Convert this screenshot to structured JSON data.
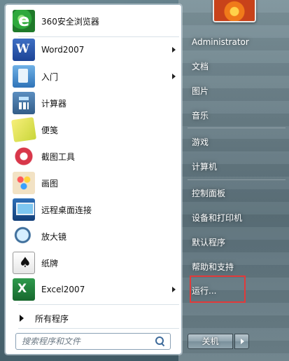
{
  "programs": [
    {
      "label": "360安全浏览器",
      "icon": "browser-360-icon",
      "has_submenu": false
    },
    {
      "label": "Word2007",
      "icon": "word-icon",
      "has_submenu": true
    },
    {
      "label": "入门",
      "icon": "getting-started-icon",
      "has_submenu": true
    },
    {
      "label": "计算器",
      "icon": "calculator-icon",
      "has_submenu": false
    },
    {
      "label": "便笺",
      "icon": "sticky-notes-icon",
      "has_submenu": false
    },
    {
      "label": "截图工具",
      "icon": "snipping-tool-icon",
      "has_submenu": false
    },
    {
      "label": "画图",
      "icon": "paint-icon",
      "has_submenu": false
    },
    {
      "label": "远程桌面连接",
      "icon": "remote-desktop-icon",
      "has_submenu": false
    },
    {
      "label": "放大镜",
      "icon": "magnifier-icon",
      "has_submenu": false
    },
    {
      "label": "纸牌",
      "icon": "solitaire-icon",
      "has_submenu": false
    },
    {
      "label": "Excel2007",
      "icon": "excel-icon",
      "has_submenu": true
    }
  ],
  "all_programs": "所有程序",
  "search": {
    "placeholder": "搜索程序和文件"
  },
  "right_items": [
    "Administrator",
    "文档",
    "图片",
    "音乐",
    "游戏",
    "计算机",
    "控制面板",
    "设备和打印机",
    "默认程序",
    "帮助和支持",
    "运行..."
  ],
  "shutdown": "关机",
  "colors": {
    "highlight": "#e23a3a"
  }
}
